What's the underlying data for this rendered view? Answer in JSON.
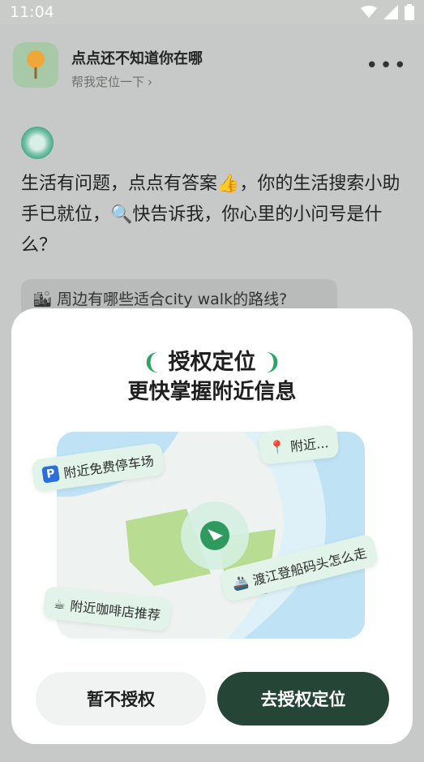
{
  "status": {
    "time": "11:04"
  },
  "header": {
    "title": "点点还不知道你在哪",
    "subtitle": "帮我定位一下"
  },
  "chat": {
    "intro": "生活有问题，点点有答案👍，你的生活搜索小助手已就位，🔍快告诉我，你心里的小问号是什么？",
    "suggestion": "🏙 周边有哪些适合city walk的路线?"
  },
  "dialog": {
    "title_left": "❨",
    "title": "授权定位",
    "title_right": "❩",
    "subtitle": "更快掌握附近信息",
    "tags": {
      "parking": "附近免费停车场",
      "nearby": "附近...",
      "ferry": "渡江登船码头怎么走",
      "coffee": "附近咖啡店推荐"
    },
    "decline_label": "暂不授权",
    "accept_label": "去授权定位"
  },
  "colors": {
    "accent": "#2aa662",
    "primary_button": "#254637"
  }
}
